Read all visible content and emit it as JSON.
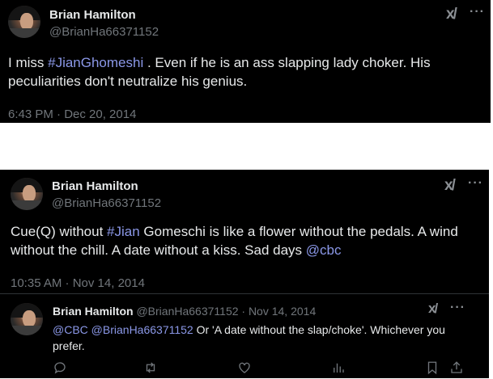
{
  "tweet1": {
    "author_name": "Brian Hamilton",
    "author_handle": "@BrianHa66371152",
    "text_before": "I miss ",
    "hashtag": "#JianGhomeshi",
    "text_after": " . Even if he is an ass slapping lady choker. His peculiarities don't neutralize his genius.",
    "timestamp": "6:43 PM · Dec 20, 2014"
  },
  "tweet2": {
    "author_name": "Brian Hamilton",
    "author_handle": "@BrianHa66371152",
    "text_before": "Cue(Q) without ",
    "hashtag": "#Jian",
    "text_middle": " Gomeschi is like a flower without the pedals. A wind without the chill. A date without a kiss. Sad days ",
    "mention": "@cbc",
    "timestamp": "10:35 AM · Nov 14, 2014"
  },
  "reply": {
    "author_name": "Brian Hamilton",
    "author_meta": "@BrianHa66371152 · Nov 14, 2014",
    "mention_1": "@CBC",
    "mention_2": "@BrianHa66371152",
    "text": " Or 'A date without the slap/choke'.  Whichever you prefer."
  },
  "icons": {
    "grok": "grok-icon",
    "more": "more-icon",
    "actions": [
      "reply-icon",
      "retweet-icon",
      "like-icon",
      "views-icon",
      "bookmark-icon",
      "share-icon"
    ]
  },
  "colors": {
    "link": "#8b98e8",
    "background": "#000000",
    "muted": "#71767b"
  }
}
